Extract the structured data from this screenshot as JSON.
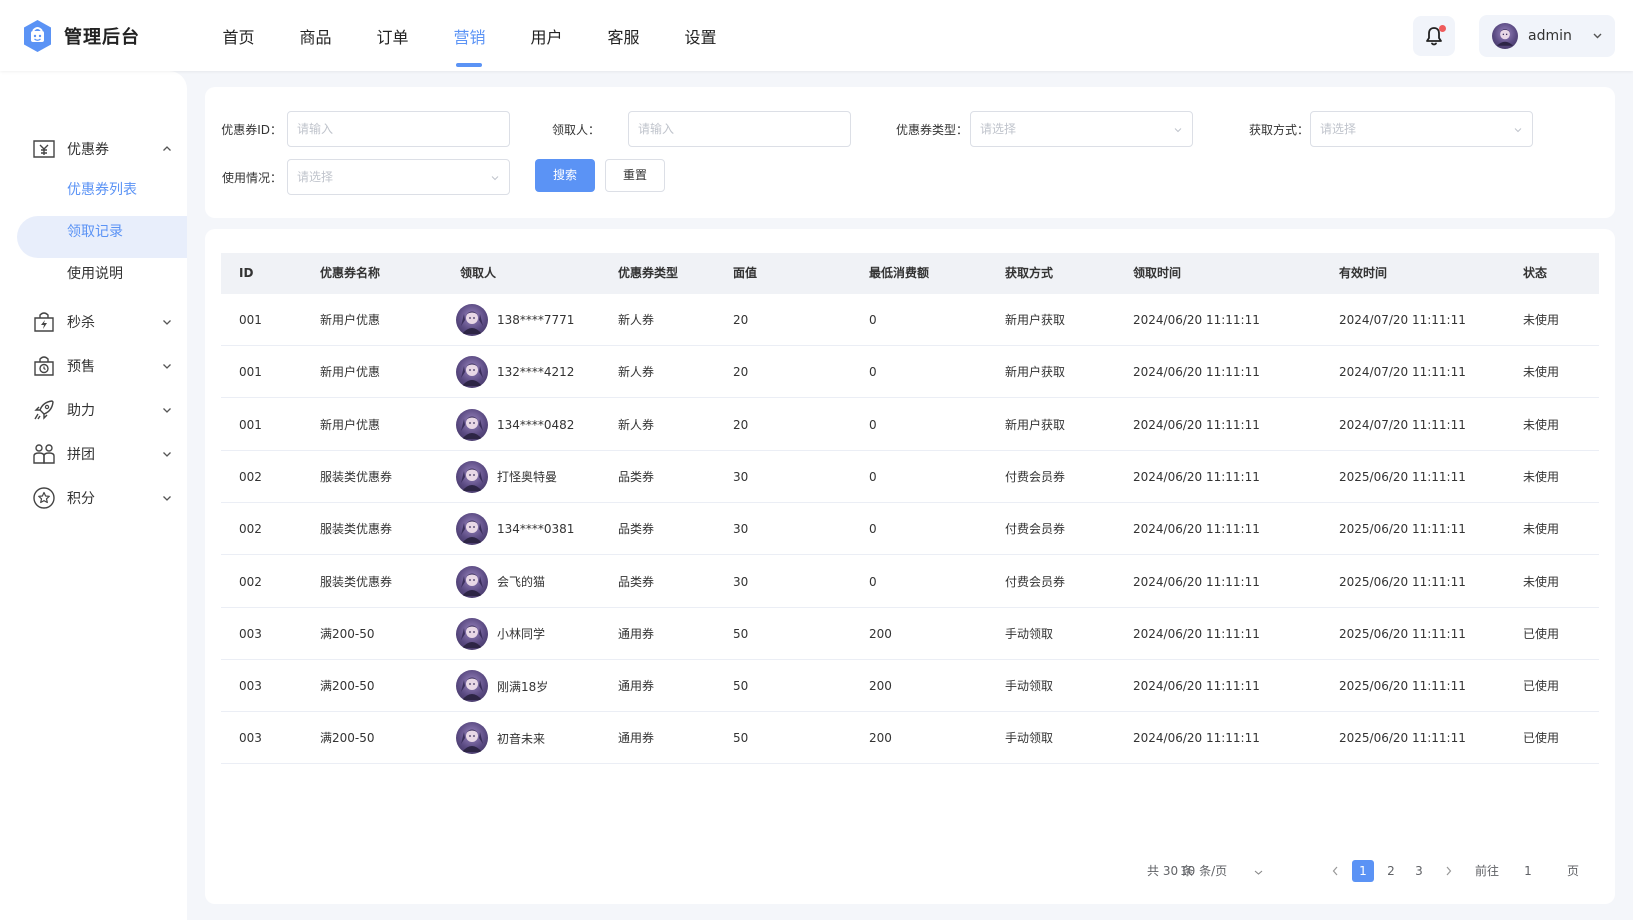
{
  "app": {
    "title": "管理后台",
    "accent": "#5b93f5"
  },
  "top_nav": {
    "items": [
      "首页",
      "商品",
      "订单",
      "营销",
      "用户",
      "客服",
      "设置"
    ],
    "active": "营销"
  },
  "user": {
    "name": "admin"
  },
  "sidebar": {
    "groups": [
      {
        "label": "优惠券",
        "icon": "coupon-icon",
        "expanded": true,
        "items": [
          "优惠券列表",
          "领取记录",
          "使用说明"
        ],
        "active_item": "领取记录"
      },
      {
        "label": "秒杀",
        "icon": "flash-bag-icon",
        "expanded": false
      },
      {
        "label": "预售",
        "icon": "clock-bag-icon",
        "expanded": false
      },
      {
        "label": "助力",
        "icon": "rocket-icon",
        "expanded": false
      },
      {
        "label": "拼团",
        "icon": "group-icon",
        "expanded": false
      },
      {
        "label": "积分",
        "icon": "star-circle-icon",
        "expanded": false
      }
    ]
  },
  "filters": {
    "coupon_id": {
      "label": "优惠券ID：",
      "placeholder": "请输入",
      "value": ""
    },
    "receiver": {
      "label": "领取人：",
      "placeholder": "请输入",
      "value": ""
    },
    "coupon_type": {
      "label": "优惠券类型：",
      "placeholder": "请选择"
    },
    "acquire_method": {
      "label": "获取方式：",
      "placeholder": "请选择"
    },
    "usage": {
      "label": "使用情况：",
      "placeholder": "请选择"
    },
    "search_label": "搜索",
    "reset_label": "重置"
  },
  "table": {
    "columns": [
      "ID",
      "优惠券名称",
      "领取人",
      "优惠券类型",
      "面值",
      "最低消费额",
      "获取方式",
      "领取时间",
      "有效时间",
      "状态"
    ],
    "rows": [
      {
        "id": "001",
        "name": "新用户优惠",
        "receiver": "138****7771",
        "type": "新人券",
        "value": "20",
        "min": "0",
        "method": "新用户获取",
        "received": "2024/06/20 11:11:11",
        "valid": "2024/07/20 11:11:11",
        "status": "未使用"
      },
      {
        "id": "001",
        "name": "新用户优惠",
        "receiver": "132****4212",
        "type": "新人券",
        "value": "20",
        "min": "0",
        "method": "新用户获取",
        "received": "2024/06/20 11:11:11",
        "valid": "2024/07/20 11:11:11",
        "status": "未使用"
      },
      {
        "id": "001",
        "name": "新用户优惠",
        "receiver": "134****0482",
        "type": "新人券",
        "value": "20",
        "min": "0",
        "method": "新用户获取",
        "received": "2024/06/20 11:11:11",
        "valid": "2024/07/20 11:11:11",
        "status": "未使用"
      },
      {
        "id": "002",
        "name": "服装类优惠券",
        "receiver": "打怪奥特曼",
        "type": "品类券",
        "value": "30",
        "min": "0",
        "method": "付费会员券",
        "received": "2024/06/20 11:11:11",
        "valid": "2025/06/20 11:11:11",
        "status": "未使用"
      },
      {
        "id": "002",
        "name": "服装类优惠券",
        "receiver": "134****0381",
        "type": "品类券",
        "value": "30",
        "min": "0",
        "method": "付费会员券",
        "received": "2024/06/20 11:11:11",
        "valid": "2025/06/20 11:11:11",
        "status": "未使用"
      },
      {
        "id": "002",
        "name": "服装类优惠券",
        "receiver": "会飞的猫",
        "type": "品类券",
        "value": "30",
        "min": "0",
        "method": "付费会员券",
        "received": "2024/06/20 11:11:11",
        "valid": "2025/06/20 11:11:11",
        "status": "未使用"
      },
      {
        "id": "003",
        "name": "满200-50",
        "receiver": "小林同学",
        "type": "通用券",
        "value": "50",
        "min": "200",
        "method": "手动领取",
        "received": "2024/06/20 11:11:11",
        "valid": "2025/06/20 11:11:11",
        "status": "已使用"
      },
      {
        "id": "003",
        "name": "满200-50",
        "receiver": "刚满18岁",
        "type": "通用券",
        "value": "50",
        "min": "200",
        "method": "手动领取",
        "received": "2024/06/20 11:11:11",
        "valid": "2025/06/20 11:11:11",
        "status": "已使用"
      },
      {
        "id": "003",
        "name": "满200-50",
        "receiver": "初音未来",
        "type": "通用券",
        "value": "50",
        "min": "200",
        "method": "手动领取",
        "received": "2024/06/20 11:11:11",
        "valid": "2025/06/20 11:11:11",
        "status": "已使用"
      }
    ]
  },
  "pagination": {
    "total": "共 30 条",
    "page_size": "10 条/页",
    "pages": [
      "1",
      "2",
      "3"
    ],
    "current": "1",
    "goto_label": "前往",
    "goto_value": "1",
    "page_suffix": "页"
  }
}
